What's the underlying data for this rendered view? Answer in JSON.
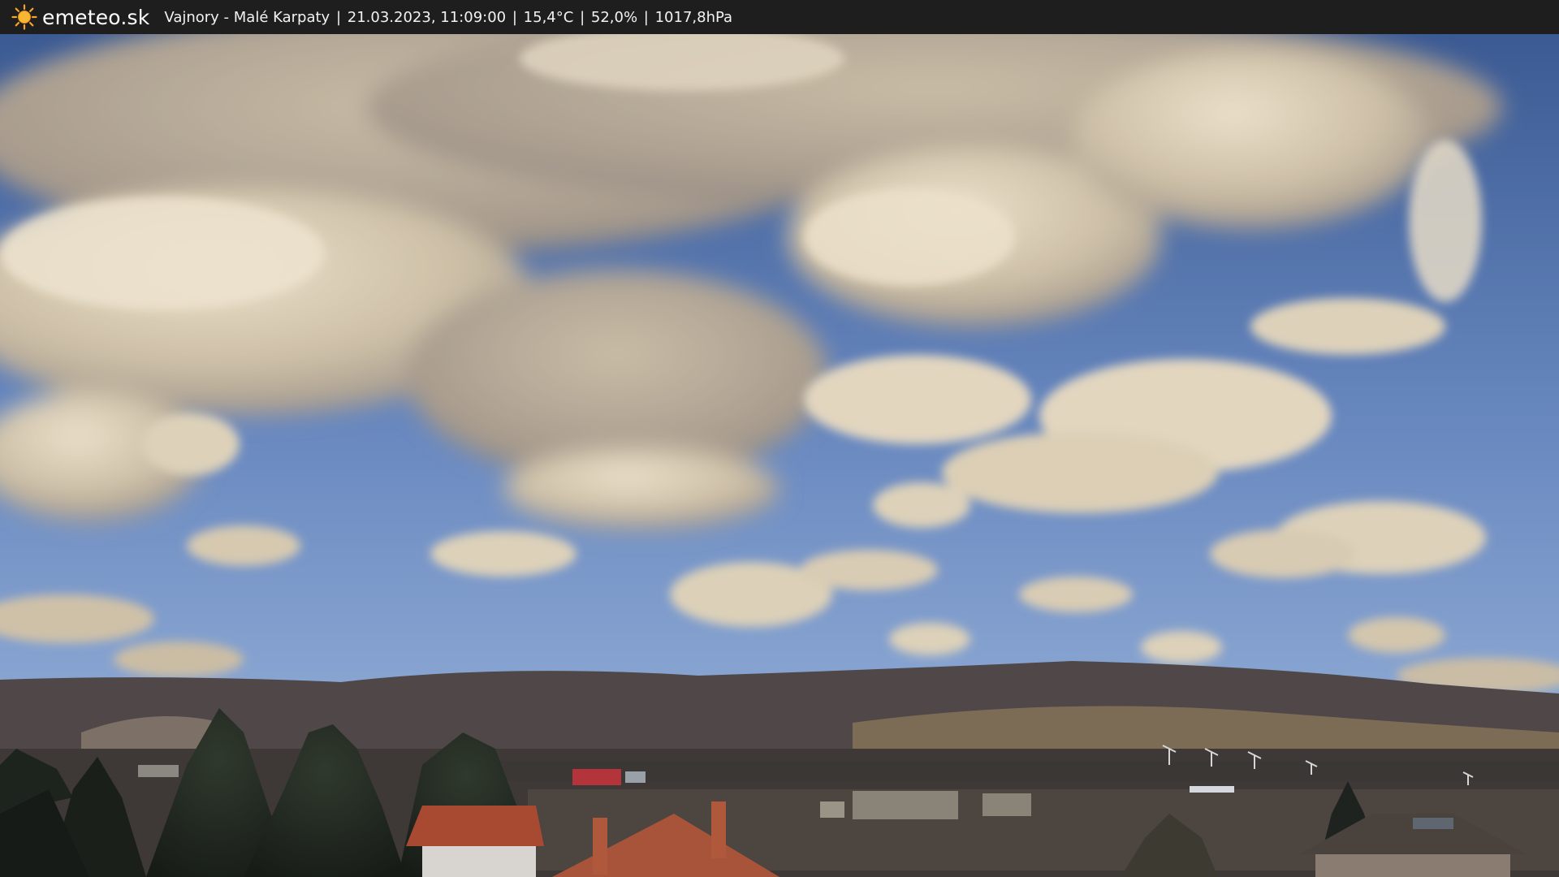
{
  "header": {
    "brand": "emeteo.sk",
    "location": "Vajnory - Malé Karpaty",
    "datetime": "21.03.2023, 11:09:00",
    "temperature": "15,4°C",
    "humidity": "52,0%",
    "pressure": "1017,8hPa",
    "separator": "|",
    "logo_icon": "sun-icon"
  },
  "colors": {
    "header_bg": "#1e1e1e",
    "sun": "#f5a623",
    "sky_top": "#3f5f96",
    "sky_bottom": "#7f9ecd",
    "cloud": "#d7cbb4",
    "roof": "#a84a32"
  }
}
